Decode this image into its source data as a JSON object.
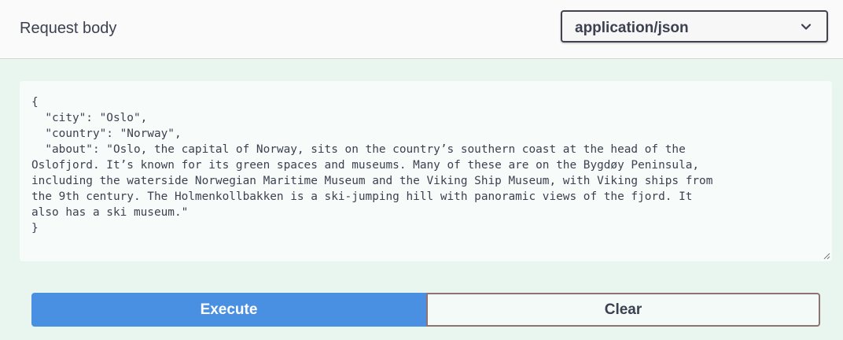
{
  "header": {
    "title": "Request body",
    "content_type": {
      "selected": "application/json",
      "icon": "chevron-down-icon"
    }
  },
  "editor": {
    "value": "{\n  \"city\": \"Oslo\",\n  \"country\": \"Norway\",\n  \"about\": \"Oslo, the capital of Norway, sits on the country’s southern coast at the head of the\nOslofjord. It’s known for its green spaces and museums. Many of these are on the Bygdøy Peninsula,\nincluding the waterside Norwegian Maritime Museum and the Viking Ship Museum, with Viking ships from\nthe 9th century. The Holmenkollbakken is a ski-jumping hill with panoramic views of the fjord. It\nalso has a ski museum.\"\n}"
  },
  "actions": {
    "execute_label": "Execute",
    "clear_label": "Clear"
  },
  "colors": {
    "execute": "#4a90e2",
    "clear_border": "#8e7372",
    "background": "#e9f6f0"
  }
}
